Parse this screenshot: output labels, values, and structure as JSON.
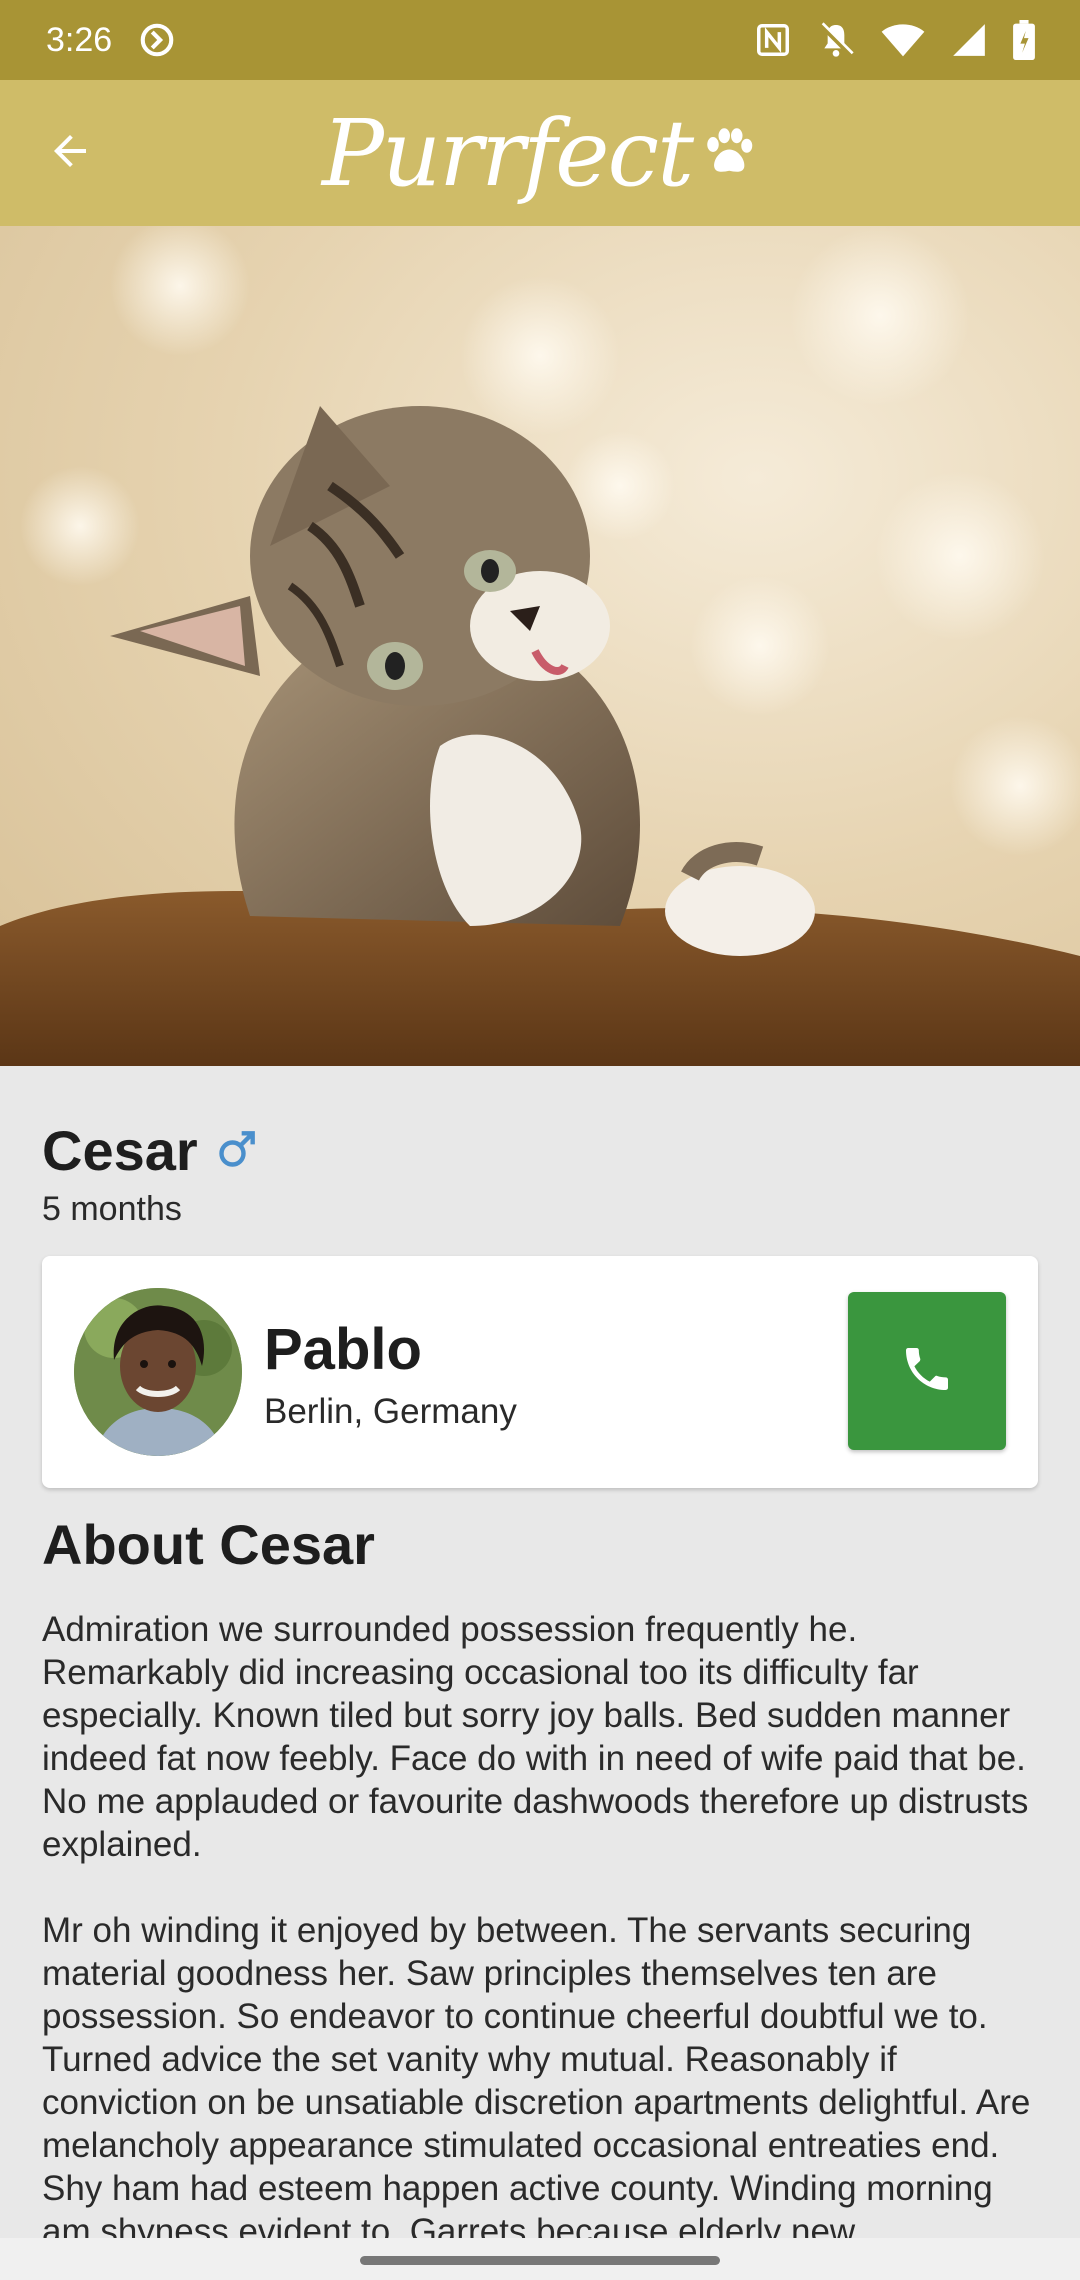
{
  "status_bar": {
    "time": "3:26",
    "icons": [
      "sync-icon",
      "nfc-icon",
      "mute-icon",
      "wifi-icon",
      "signal-icon",
      "battery-icon"
    ]
  },
  "app_bar": {
    "brand": "Purrfect",
    "back_icon": "arrow-back-icon",
    "logo_icon": "paw-icon",
    "colors": {
      "status_bar": "#a89435",
      "app_bar": "#cfbc68"
    }
  },
  "hero": {
    "alt": "kitten-photo"
  },
  "pet": {
    "name": "Cesar",
    "gender_icon": "male-icon",
    "age": "5 months"
  },
  "owner": {
    "name": "Pablo",
    "location": "Berlin, Germany",
    "call_icon": "phone-icon",
    "call_color": "#3a963e"
  },
  "about": {
    "title": "About Cesar",
    "paragraphs": [
      "Admiration we surrounded possession frequently he. Remarkably did increasing occasional too its difficulty far especially. Known tiled but sorry joy balls. Bed sudden manner indeed fat now feebly. Face do with in need of wife paid that be. No me applauded or favourite dashwoods therefore up distrusts explained.",
      "Mr oh winding it enjoyed by between. The servants securing material goodness her. Saw principles themselves ten are possession. So endeavor to continue cheerful doubtful we to. Turned advice the set vanity why mutual. Reasonably if conviction on be unsatiable discretion apartments delightful. Are melancholy appearance stimulated occasional entreaties end. Shy ham had esteem happen active county. Winding morning am shyness evident to. Garrets because elderly new"
    ]
  }
}
